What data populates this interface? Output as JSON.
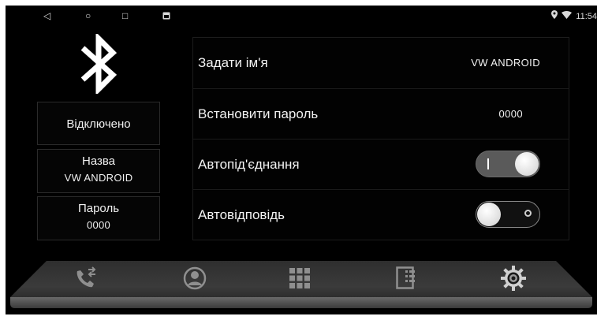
{
  "statusbar": {
    "time": "11:54",
    "nav": {
      "back": "◁",
      "home": "○",
      "recent": "□"
    },
    "icons": [
      "notification-icon",
      "location-icon",
      "wifi-icon"
    ]
  },
  "bluetooth": {
    "status_label": "Відключено",
    "name_title": "Назва",
    "name_value": "VW ANDROID",
    "pin_title": "Пароль",
    "pin_value": "0000"
  },
  "settings": {
    "rows": [
      {
        "label": "Задати ім'я",
        "value": "VW ANDROID"
      },
      {
        "label": "Встановити пароль",
        "value": "0000"
      },
      {
        "label": "Автопід'єднання",
        "toggle": true
      },
      {
        "label": "Автовідповідь",
        "toggle": false
      }
    ]
  },
  "dock": {
    "items": [
      "call-transfer-icon",
      "contacts-icon",
      "dialpad-icon",
      "call-log-icon",
      "settings-gear-icon"
    ],
    "active": "settings-gear-icon",
    "colors": {
      "icon": "#8f8f8f",
      "active": "#d0d0d0",
      "bar": "#4a4a4a"
    }
  }
}
